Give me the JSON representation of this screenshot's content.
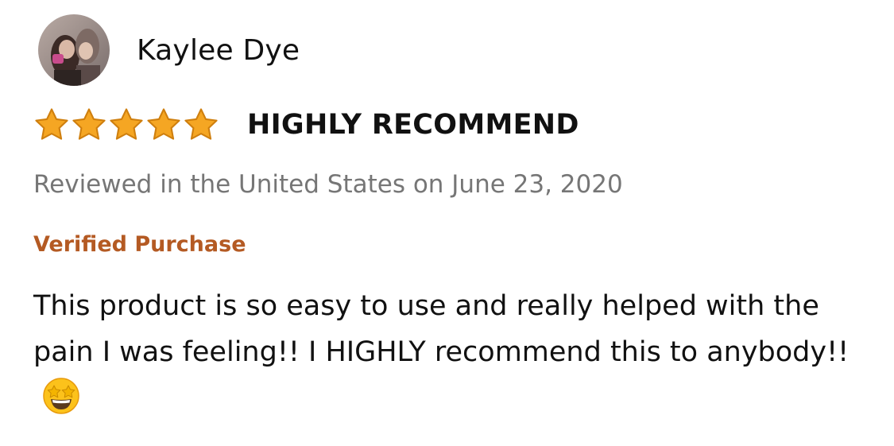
{
  "review": {
    "reviewer": {
      "name": "Kaylee Dye",
      "avatar_icon": "user-photo"
    },
    "rating": {
      "stars": 5,
      "max": 5,
      "star_color": "#f5a623"
    },
    "title": "HIGHLY RECOMMEND",
    "meta": "Reviewed in the United States on June 23, 2020",
    "verified_label": "Verified Purchase",
    "verified_color": "#b45a23",
    "body": "This product is so easy to use and really helped with the pain I was feeling!! I HIGHLY recommend this to anybody!!",
    "body_emoji": "star-struck-emoji"
  }
}
